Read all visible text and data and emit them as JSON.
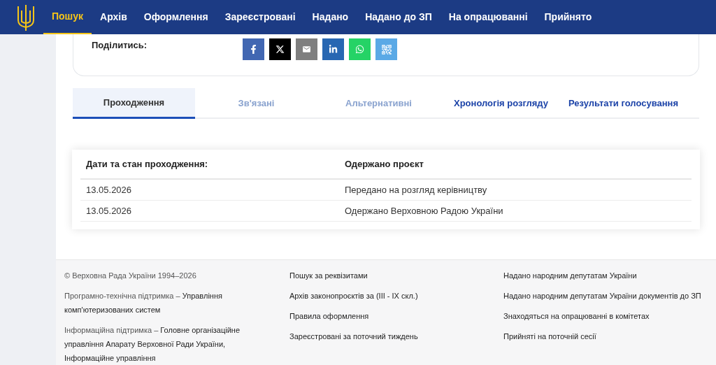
{
  "nav": {
    "items": [
      {
        "label": "Пошук",
        "selected": true
      },
      {
        "label": "Архів",
        "selected": false
      },
      {
        "label": "Оформлення",
        "selected": false
      },
      {
        "label": "Зареєстровані",
        "selected": false
      },
      {
        "label": "Надано",
        "selected": false
      },
      {
        "label": "Надано до ЗП",
        "selected": false
      },
      {
        "label": "На опрацюванні",
        "selected": false
      },
      {
        "label": "Прийнято",
        "selected": false
      }
    ]
  },
  "share": {
    "label": "Поділитись:",
    "buttons": [
      {
        "kind": "facebook"
      },
      {
        "kind": "x"
      },
      {
        "kind": "email"
      },
      {
        "kind": "linkedin"
      },
      {
        "kind": "whatsapp"
      },
      {
        "kind": "qr"
      }
    ]
  },
  "tabs": [
    {
      "label": "Проходження",
      "selected": true,
      "disabled": false
    },
    {
      "label": "Зв'язані",
      "selected": false,
      "disabled": true
    },
    {
      "label": "Альтернативні",
      "selected": false,
      "disabled": true
    },
    {
      "label": "Хронологія розгляду",
      "selected": false,
      "disabled": false
    },
    {
      "label": "Результати голосування",
      "selected": false,
      "disabled": false
    }
  ],
  "table": {
    "columns": [
      "Дати та стан проходження:",
      "Одержано проєкт"
    ],
    "rows": [
      [
        "13.05.2026",
        "Передано на розгляд керівництву"
      ],
      [
        "13.05.2026",
        "Одержано Верховною Радою України"
      ]
    ]
  },
  "footer": {
    "columns": [
      [
        {
          "lead": "© Верховна Рада України 1994–2026"
        },
        {
          "lead": "Програмно-технічна підтримка – ",
          "text": "Управління комп'ютеризованих систем"
        },
        {
          "lead": "Інформаційна підтримка – ",
          "text": "Головне організаційне управління Апарату Верховної Ради України, Інформаційне управління"
        }
      ],
      [
        {
          "text": "Пошук за реквізитами"
        },
        {
          "text": "Архів законопроєктів за (III - IX скл.)"
        },
        {
          "text": "Правила оформлення"
        },
        {
          "text": "Зареєстровані за поточний тиждень"
        }
      ],
      [
        {
          "text": "Надано народним депутатам України"
        },
        {
          "text": "Надано народним депутатам України документів до ЗП"
        },
        {
          "text": "Знаходяться на опрацюванні в комітетах"
        },
        {
          "text": "Прийняті на поточній сесії"
        }
      ]
    ]
  }
}
